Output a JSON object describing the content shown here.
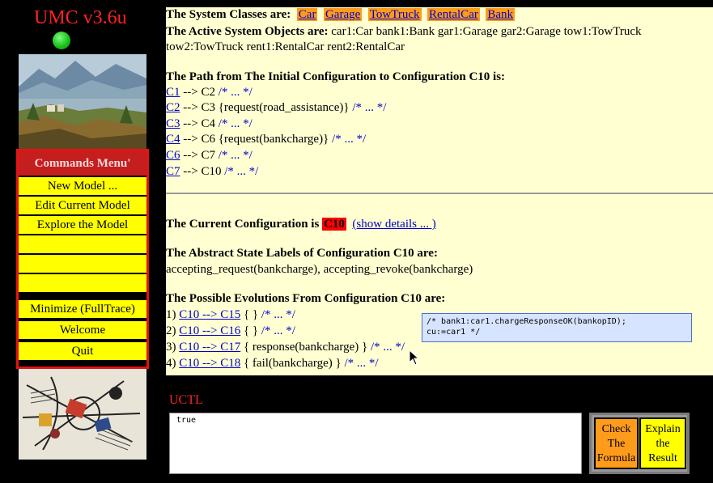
{
  "app": {
    "title": "UMC v3.6u"
  },
  "menu": {
    "header": "Commands Menu'",
    "items": [
      "New Model ...",
      "Edit Current Model",
      "Explore the Model",
      "",
      "",
      "",
      "Minimize (FullTrace)",
      "Welcome",
      "Quit"
    ]
  },
  "classes": {
    "label": "The System Classes are:",
    "items": [
      "Car",
      "Garage",
      "TowTruck",
      "RentalCar",
      "Bank"
    ]
  },
  "objects": {
    "label": "The Active System Objects are:",
    "line1": "car1:Car bank1:Bank gar1:Garage gar2:Garage tow1:TowTruck",
    "line2": "tow2:TowTruck rent1:RentalCar rent2:RentalCar"
  },
  "path": {
    "heading": "The Path from The Initial Configuration to Configuration C10 is:",
    "steps": [
      {
        "from": "C1",
        "rest": " --> C2 ",
        "comment": "/* ... */"
      },
      {
        "from": "C2",
        "rest": " --> C3 {request(road_assistance)} ",
        "comment": "/* ... */"
      },
      {
        "from": "C3",
        "rest": " --> C4 ",
        "comment": "/* ... */"
      },
      {
        "from": "C4",
        "rest": " --> C6 {request(bankcharge)} ",
        "comment": "/* ... */"
      },
      {
        "from": "C6",
        "rest": " --> C7 ",
        "comment": "/* ... */"
      },
      {
        "from": "C7",
        "rest": " --> C10 ",
        "comment": "/* ... */"
      }
    ]
  },
  "current": {
    "label": "The Current Configuration is",
    "config": "C10",
    "details_link": "(show details ... )"
  },
  "labels": {
    "heading": "The Abstract State Labels of Configuration C10 are:",
    "text": "accepting_request(bankcharge), accepting_revoke(bankcharge)"
  },
  "evolutions": {
    "heading": "The Possible Evolutions From Configuration C10 are:",
    "items": [
      {
        "num": "1)",
        "link": "C10 --> C15",
        "rest": " { } ",
        "comment": "/* ... */"
      },
      {
        "num": "2)",
        "link": "C10 --> C16",
        "rest": " { } ",
        "comment": "/* ... */"
      },
      {
        "num": "3)",
        "link": "C10 --> C17",
        "rest": " { response(bankcharge) } ",
        "comment": "/* ... */"
      },
      {
        "num": "4)",
        "link": "C10 --> C18",
        "rest": " { fail(bankcharge) } ",
        "comment": "/* ... */"
      }
    ]
  },
  "tooltip": {
    "line1": "/* bank1:car1.chargeResponseOK(bankopID);",
    "line2": "cu:=car1 */"
  },
  "uctl": {
    "label": "UCTL",
    "value": "true",
    "check_button": [
      "Check",
      "The",
      "Formula"
    ],
    "explain_button": [
      "Explain",
      "the",
      "Result"
    ]
  }
}
